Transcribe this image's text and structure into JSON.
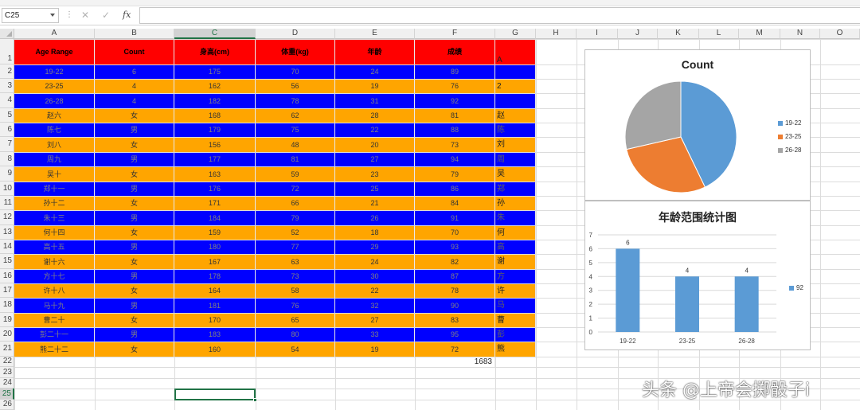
{
  "formula_bar": {
    "name_box": "C25",
    "fx_label": "fx",
    "cancel_icon": "close-icon",
    "enter_icon": "check-icon",
    "formula": ""
  },
  "column_headers": [
    "A",
    "B",
    "C",
    "D",
    "E",
    "F",
    "G",
    "H",
    "I",
    "J",
    "K",
    "L",
    "M",
    "N",
    "O"
  ],
  "selected_column": "C",
  "row_numbers": [
    "1",
    "2",
    "3",
    "4",
    "5",
    "6",
    "7",
    "8",
    "9",
    "10",
    "11",
    "12",
    "13",
    "14",
    "15",
    "16",
    "17",
    "18",
    "19",
    "20",
    "21",
    "22",
    "23",
    "24",
    "25",
    "26"
  ],
  "selected_row": "25",
  "table": {
    "headers": [
      "Age Range",
      "Count",
      "身高(cm)",
      "体重(kg)",
      "年龄",
      "成绩"
    ],
    "header_g": "A",
    "rows": [
      {
        "style": "blue",
        "cells": [
          "19-22",
          "6",
          "175",
          "70",
          "24",
          "89"
        ],
        "g": ""
      },
      {
        "style": "orange",
        "cells": [
          "23-25",
          "4",
          "162",
          "56",
          "19",
          "76"
        ],
        "g": "2"
      },
      {
        "style": "blue",
        "cells": [
          "26-28",
          "4",
          "182",
          "78",
          "31",
          "92"
        ],
        "g": ""
      },
      {
        "style": "orange",
        "cells": [
          "赵六",
          "女",
          "168",
          "62",
          "28",
          "81"
        ],
        "g": "赵"
      },
      {
        "style": "blue",
        "cells": [
          "陈七",
          "男",
          "179",
          "75",
          "22",
          "88"
        ],
        "g": "陈"
      },
      {
        "style": "orange",
        "cells": [
          "刘八",
          "女",
          "156",
          "48",
          "20",
          "73"
        ],
        "g": "刘"
      },
      {
        "style": "blue",
        "cells": [
          "周九",
          "男",
          "177",
          "81",
          "27",
          "94"
        ],
        "g": "周"
      },
      {
        "style": "orange",
        "cells": [
          "吴十",
          "女",
          "163",
          "59",
          "23",
          "79"
        ],
        "g": "吴"
      },
      {
        "style": "blue",
        "cells": [
          "郑十一",
          "男",
          "176",
          "72",
          "25",
          "86"
        ],
        "g": "郑"
      },
      {
        "style": "orange",
        "cells": [
          "孙十二",
          "女",
          "171",
          "66",
          "21",
          "84"
        ],
        "g": "孙"
      },
      {
        "style": "blue",
        "cells": [
          "朱十三",
          "男",
          "184",
          "79",
          "26",
          "91"
        ],
        "g": "朱"
      },
      {
        "style": "orange",
        "cells": [
          "何十四",
          "女",
          "159",
          "52",
          "18",
          "70"
        ],
        "g": "何"
      },
      {
        "style": "blue",
        "cells": [
          "高十五",
          "男",
          "180",
          "77",
          "29",
          "93"
        ],
        "g": "高"
      },
      {
        "style": "orange",
        "cells": [
          "谢十六",
          "女",
          "167",
          "63",
          "24",
          "82"
        ],
        "g": "谢"
      },
      {
        "style": "blue",
        "cells": [
          "方十七",
          "男",
          "178",
          "73",
          "30",
          "87"
        ],
        "g": "方"
      },
      {
        "style": "orange",
        "cells": [
          "许十八",
          "女",
          "164",
          "58",
          "22",
          "78"
        ],
        "g": "许"
      },
      {
        "style": "blue",
        "cells": [
          "马十九",
          "男",
          "181",
          "76",
          "32",
          "90"
        ],
        "g": "马"
      },
      {
        "style": "orange",
        "cells": [
          "曹二十",
          "女",
          "170",
          "65",
          "27",
          "83"
        ],
        "g": "曹"
      },
      {
        "style": "blue",
        "cells": [
          "彭二十一",
          "男",
          "183",
          "80",
          "33",
          "95"
        ],
        "g": "彭"
      },
      {
        "style": "orange",
        "cells": [
          "熊二十二",
          "女",
          "160",
          "54",
          "19",
          "72"
        ],
        "g": "熊"
      }
    ],
    "sum_f22": "1683"
  },
  "colors": {
    "header_red": "#ff0000",
    "row_blue": "#0000ff",
    "row_orange": "#ffa500",
    "excel_green": "#217346"
  },
  "chart_data": [
    {
      "type": "pie",
      "title": "Count",
      "categories": [
        "19-22",
        "23-25",
        "26-28"
      ],
      "values": [
        6,
        4,
        4
      ],
      "colors": [
        "#5b9bd5",
        "#ed7d31",
        "#a5a5a5"
      ],
      "legend": "right"
    },
    {
      "type": "bar",
      "title": "年龄范围统计图",
      "categories": [
        "19-22",
        "23-25",
        "26-28"
      ],
      "series": [
        {
          "name": "92",
          "values": [
            6,
            4,
            4
          ]
        }
      ],
      "data_labels": [
        "6",
        "4",
        "4"
      ],
      "ylim": [
        0,
        7
      ],
      "yticks": [
        "0",
        "1",
        "2",
        "3",
        "4",
        "5",
        "6",
        "7"
      ],
      "grid": true,
      "legend": "right",
      "color": "#5b9bd5"
    }
  ],
  "watermark": "头条 @上帝会掷骰子i"
}
